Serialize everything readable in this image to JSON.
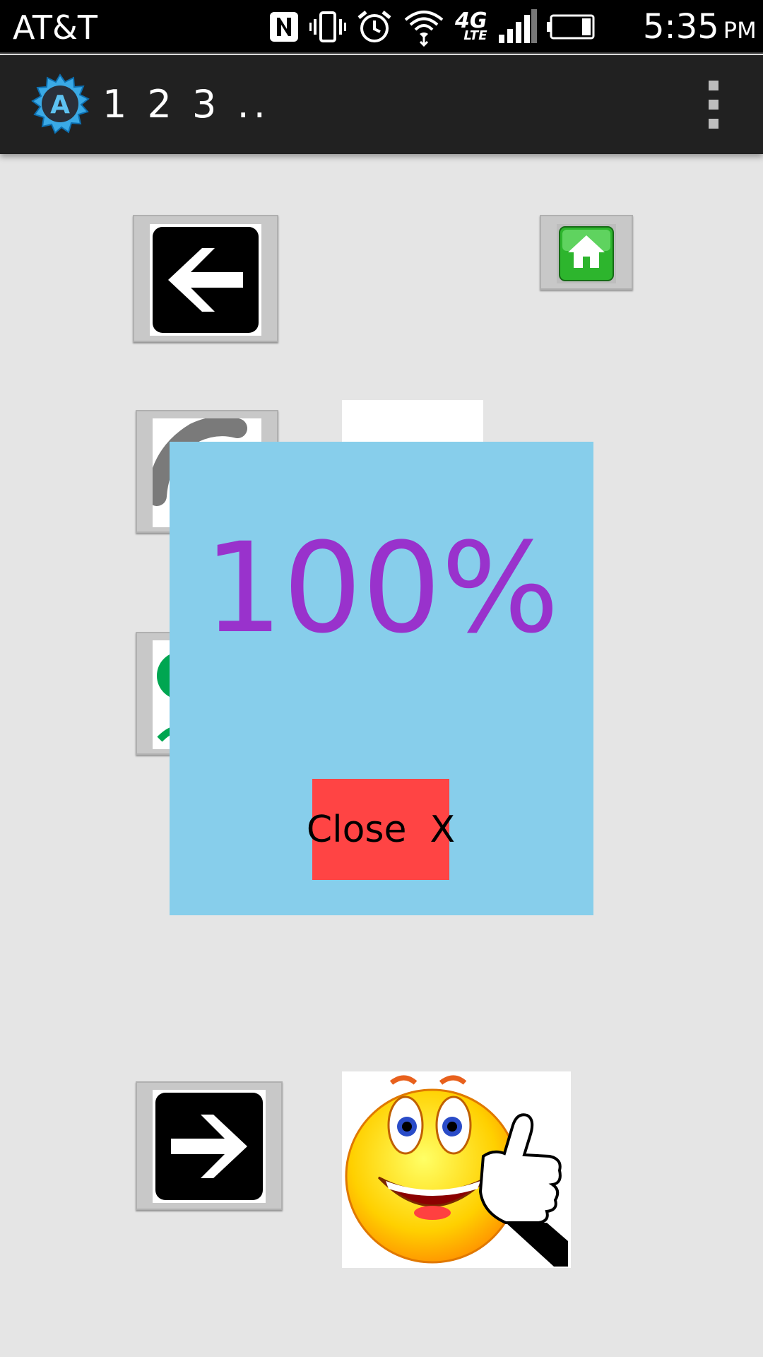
{
  "status_bar": {
    "carrier": "AT&T",
    "time": "5:35",
    "ampm": "PM",
    "network_badge": "4G",
    "network_badge_sub": "LTE",
    "icons": [
      "nfc-icon",
      "vibrate-icon",
      "alarm-icon",
      "wifi-icon",
      "network-4g-lte-icon",
      "signal-icon",
      "battery-icon"
    ]
  },
  "action_bar": {
    "app_icon": "app-logo-a-icon",
    "title": "1 2 3 ..",
    "overflow_icon": "overflow-menu-icon"
  },
  "screen": {
    "back_button": {
      "icon": "back-arrow-icon"
    },
    "home_button": {
      "icon": "home-icon"
    },
    "item_buttons": [
      {
        "icon": "quiz-picture-1-icon"
      },
      {
        "icon": "quiz-picture-2-icon"
      }
    ],
    "next_button": {
      "icon": "next-arrow-icon"
    },
    "feedback_image": {
      "icon": "smiley-thumbs-up-icon"
    }
  },
  "result_popup": {
    "score": "100%",
    "close_label": "Close  X",
    "colors": {
      "background": "#87ceeb",
      "score": "#9932cc",
      "close_button": "#ff4444"
    }
  }
}
